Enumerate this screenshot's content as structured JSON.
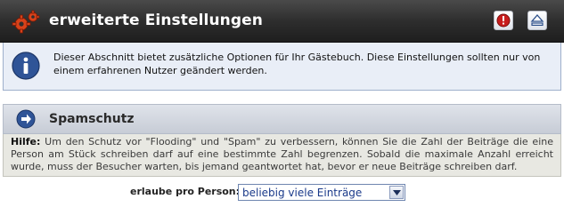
{
  "header": {
    "title": "erweiterte Einstellungen",
    "icon": "gear-icon",
    "buttons": [
      "info-icon",
      "up-arrow-icon"
    ]
  },
  "description": {
    "icon": "info-icon",
    "text": "Dieser Abschnitt bietet zusätzliche Optionen für Ihr Gästebuch. Diese Einstellungen sollten nur von einem erfahrenen Nutzer geändert werden."
  },
  "section": {
    "title": "Spamschutz",
    "icon": "arrow-right-circle-icon"
  },
  "help": {
    "label": "Hilfe:",
    "text": "Um den Schutz vor \"Flooding\" und \"Spam\" zu verbessern, können Sie die Zahl der Beiträge die eine Person am Stück schreiben darf auf eine bestimmte Zahl begrenzen. Sobald die maximale Anzahl erreicht wurde, muss der Besucher warten, bis jemand geantwortet hat, bevor er neue Beiträge schreiben darf."
  },
  "form": {
    "label": "erlaube pro Person:",
    "selected": "beliebig viele Einträge"
  },
  "colors": {
    "header_bg": "#2e2e2e",
    "description_bg": "#e9eef7",
    "section_bg": "#d3d8e1",
    "help_bg": "#e8e8e2",
    "select_text": "#1a3a8a"
  }
}
